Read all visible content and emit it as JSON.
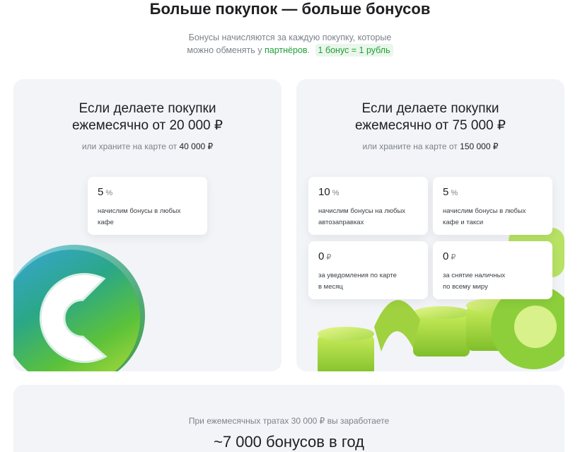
{
  "header": {
    "title": "Больше покупок — больше бонусов",
    "subtitle_line1": "Бонусы начисляются за каждую покупку, которые",
    "subtitle_line2_prefix": "можно обменять у",
    "partners_link": "партнёров",
    "subtitle_period": ".",
    "rate_badge": "1 бонус = 1 рубль"
  },
  "tier1": {
    "heading_line1": "Если делаете покупки",
    "heading_line2": "ежемесячно от 20 000 ₽",
    "alt_prefix": "или храните на карте от",
    "alt_amount": "40 000 ₽",
    "tiles": [
      {
        "value": "5",
        "unit": "%",
        "line1": "начислим бонусы в любых",
        "line2": "кафе"
      }
    ]
  },
  "tier2": {
    "heading_line1": "Если делаете покупки",
    "heading_line2": "ежемесячно от 75 000 ₽",
    "alt_prefix": "или храните на карте от",
    "alt_amount": "150 000 ₽",
    "tiles": [
      {
        "value": "10",
        "unit": "%",
        "line1": "начислим бонусы на любых",
        "line2": "автозаправках"
      },
      {
        "value": "5",
        "unit": "%",
        "line1": "начислим бонусы в любых",
        "line2": "кафе и такси"
      },
      {
        "value": "0",
        "unit": "₽",
        "line1": "за уведомления по карте",
        "line2": "в месяц"
      },
      {
        "value": "0",
        "unit": "₽",
        "line1": "за снятие наличных",
        "line2": "по всему миру"
      }
    ]
  },
  "earnings": {
    "caption": "При ежемесячных тратах 30 000 ₽ вы заработаете",
    "amount": "~7 000 бонусов в год"
  },
  "colors": {
    "accent": "#21a038",
    "card_bg": "#f2f4f7",
    "text_primary": "#1f1f22",
    "text_secondary": "#7d838a"
  }
}
